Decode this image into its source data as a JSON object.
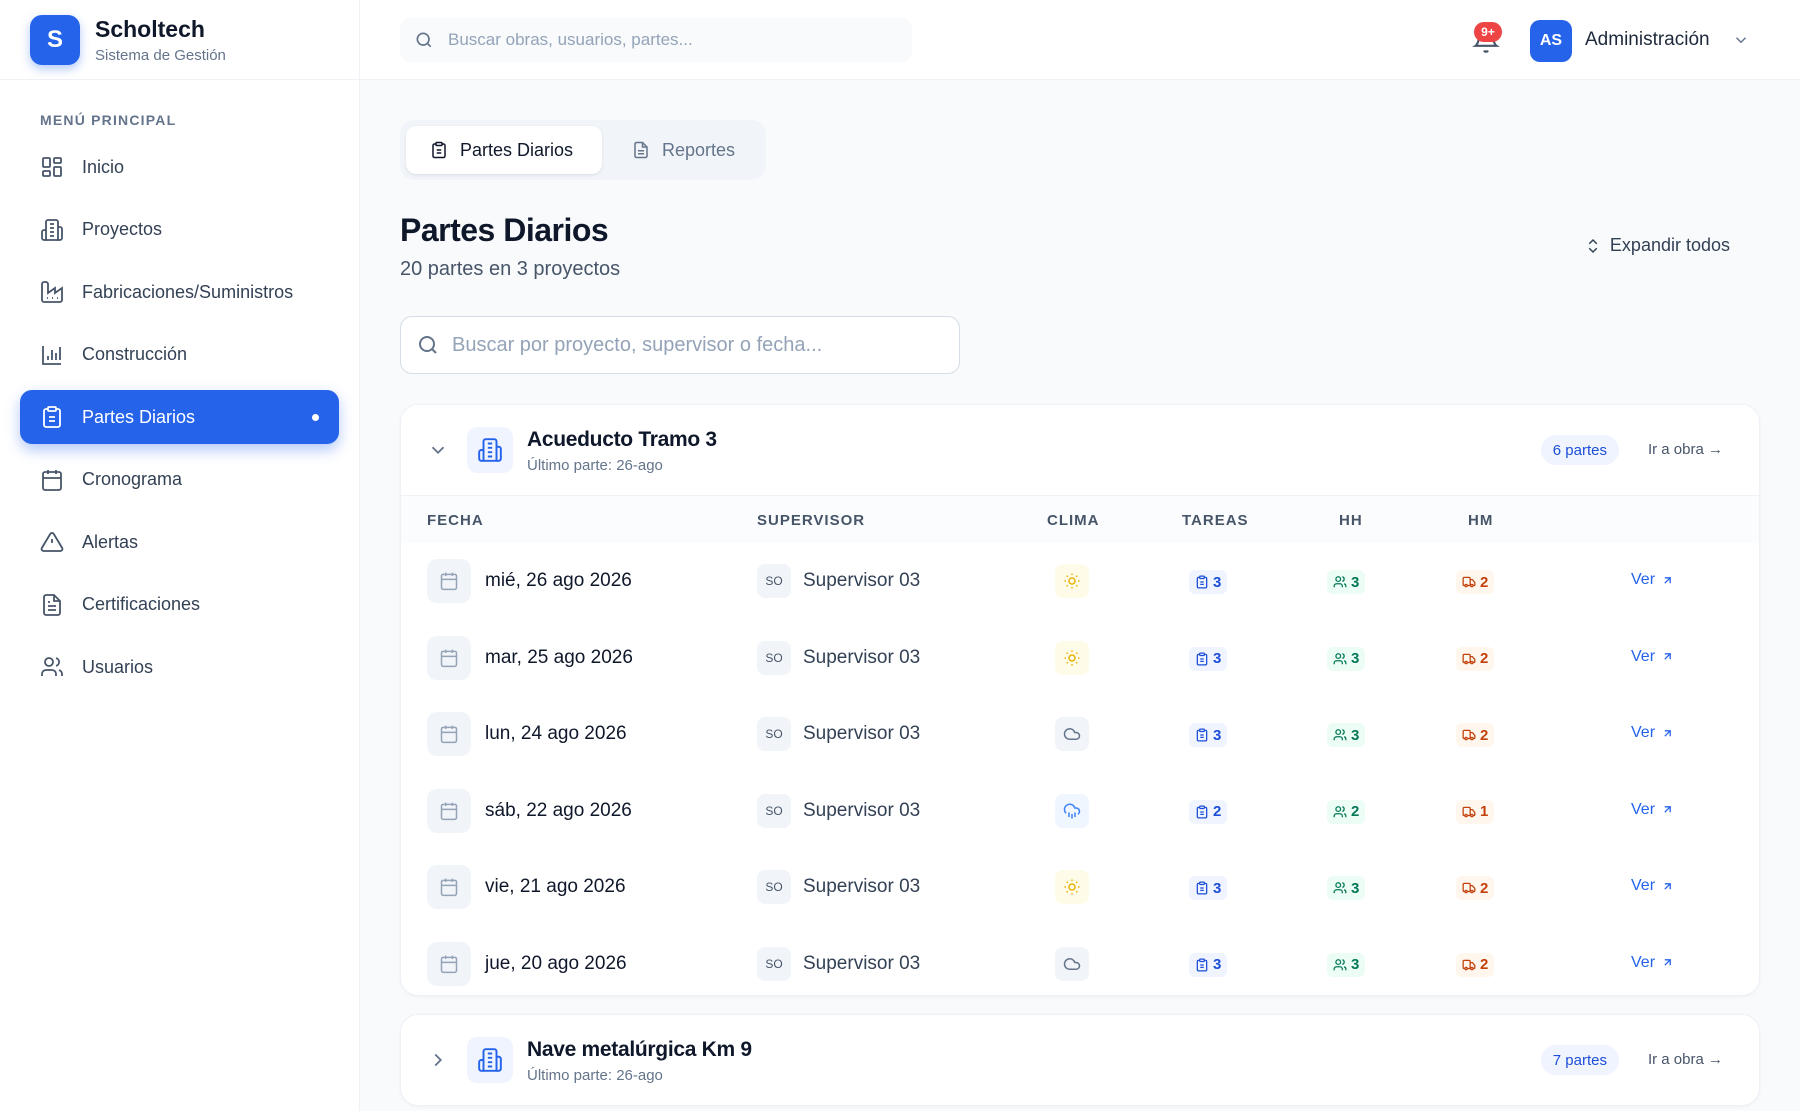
{
  "brand": {
    "logo_letter": "S",
    "name": "Scholtech",
    "subtitle": "Sistema de Gestión"
  },
  "sidebar": {
    "heading": "MENÚ PRINCIPAL",
    "items": [
      {
        "label": "Inicio",
        "icon": "grid-icon"
      },
      {
        "label": "Proyectos",
        "icon": "building-icon"
      },
      {
        "label": "Fabricaciones/Suministros",
        "icon": "factory-icon"
      },
      {
        "label": "Construcción",
        "icon": "bar-chart-icon"
      },
      {
        "label": "Partes Diarios",
        "icon": "clipboard-icon",
        "active": true
      },
      {
        "label": "Cronograma",
        "icon": "calendar-icon"
      },
      {
        "label": "Alertas",
        "icon": "alert-triangle-icon"
      },
      {
        "label": "Certificaciones",
        "icon": "file-text-icon"
      },
      {
        "label": "Usuarios",
        "icon": "users-icon"
      }
    ]
  },
  "header": {
    "search_placeholder": "Buscar obras, usuarios, partes...",
    "notification_count": "9+",
    "user_initials": "AS",
    "user_name": "Administración"
  },
  "tabs": [
    {
      "label": "Partes Diarios",
      "active": true
    },
    {
      "label": "Reportes",
      "active": false
    }
  ],
  "page": {
    "title": "Partes Diarios",
    "subtitle": "20 partes en 3 proyectos",
    "expand_all": "Expandir todos",
    "filter_placeholder": "Buscar por proyecto, supervisor o fecha..."
  },
  "table_headers": {
    "fecha": "FECHA",
    "supervisor": "SUPERVISOR",
    "clima": "CLIMA",
    "tareas": "TAREAS",
    "hh": "HH",
    "hm": "HM"
  },
  "projects": [
    {
      "name": "Acueducto Tramo 3",
      "last_part": "Último parte: 26-ago",
      "parts_count": "6 partes",
      "go_link": "Ir a obra →",
      "expanded": true,
      "rows": [
        {
          "date": "mié, 26 ago 2026",
          "sup_initials": "SO",
          "supervisor": "Supervisor 03",
          "weather": "sun",
          "tareas": "3",
          "hh": "3",
          "hm": "2",
          "action": "Ver"
        },
        {
          "date": "mar, 25 ago 2026",
          "sup_initials": "SO",
          "supervisor": "Supervisor 03",
          "weather": "sun",
          "tareas": "3",
          "hh": "3",
          "hm": "2",
          "action": "Ver"
        },
        {
          "date": "lun, 24 ago 2026",
          "sup_initials": "SO",
          "supervisor": "Supervisor 03",
          "weather": "cloud",
          "tareas": "3",
          "hh": "3",
          "hm": "2",
          "action": "Ver"
        },
        {
          "date": "sáb, 22 ago 2026",
          "sup_initials": "SO",
          "supervisor": "Supervisor 03",
          "weather": "rain",
          "tareas": "2",
          "hh": "2",
          "hm": "1",
          "action": "Ver"
        },
        {
          "date": "vie, 21 ago 2026",
          "sup_initials": "SO",
          "supervisor": "Supervisor 03",
          "weather": "sun",
          "tareas": "3",
          "hh": "3",
          "hm": "2",
          "action": "Ver"
        },
        {
          "date": "jue, 20 ago 2026",
          "sup_initials": "SO",
          "supervisor": "Supervisor 03",
          "weather": "cloud",
          "tareas": "3",
          "hh": "3",
          "hm": "2",
          "action": "Ver"
        }
      ]
    },
    {
      "name": "Nave metalúrgica Km 9",
      "last_part": "Último parte: 26-ago",
      "parts_count": "7 partes",
      "go_link": "Ir a obra →",
      "expanded": false,
      "rows": []
    }
  ],
  "colors": {
    "accent": "#2563eb",
    "badge_red": "#ef4444"
  }
}
